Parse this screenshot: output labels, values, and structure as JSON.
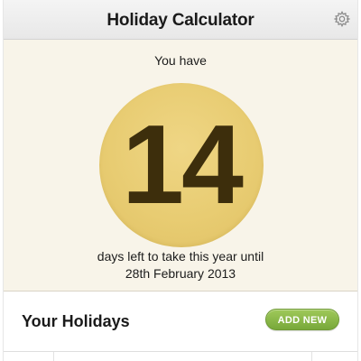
{
  "titlebar": {
    "title": "Holiday Calculator",
    "settings_icon": "gear-icon"
  },
  "summary": {
    "prefix": "You have",
    "days_left": "14",
    "suffix": "days left to take this year until",
    "until_date": "28th February 2013"
  },
  "holidays": {
    "title": "Your Holidays",
    "add_button_label": "ADD NEW"
  },
  "colors": {
    "summary_background": "#f8f4e9",
    "circle_gold": "#e8cc72",
    "number_dark_brown": "#3d2e0c",
    "add_button_green": "#8bb849"
  }
}
